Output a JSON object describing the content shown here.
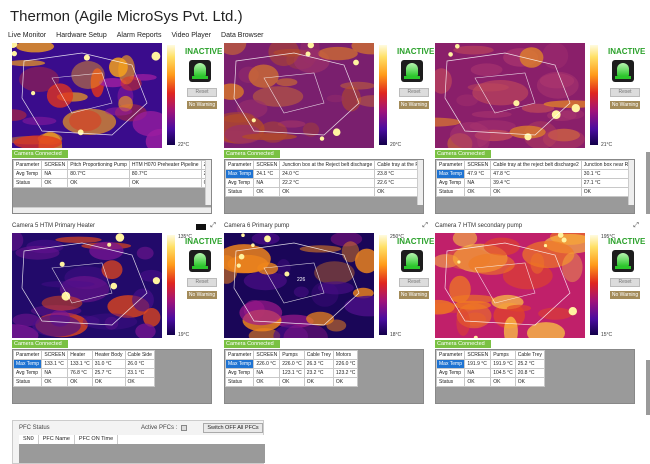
{
  "app": {
    "title": "Thermon (Agile MicroSys Pvt. Ltd.)"
  },
  "menu": [
    "Live Monitor",
    "Hardware Setup",
    "Alarm Reports",
    "Video Player",
    "Data Browser"
  ],
  "common": {
    "status": "INACTIVE",
    "reset": "Reset",
    "no_warning": "No Warning",
    "connected": "Camera Connected",
    "expand_icon": "expand-arrows-icon",
    "colors": {
      "status_green": "#2aa12a",
      "connected_green": "#7ac143",
      "highlight_blue": "#1e73d2",
      "warning_tan": "#a38b5a"
    }
  },
  "cameras": [
    {
      "title": "",
      "temp_high": "",
      "temp_low": "22°C",
      "columns": [
        "Parameter",
        "SCREEN",
        "Pitch Proportioning Pump",
        "HTM H070 Preheater Pipeline",
        "Z"
      ],
      "rows": [
        [
          "Avg Temp",
          "NA",
          "80.7°C",
          "80.7°C",
          "2"
        ],
        [
          "Status",
          "OK",
          "OK",
          "OK",
          "C"
        ]
      ]
    },
    {
      "title": "",
      "temp_high": "",
      "temp_low": "20°C",
      "columns": [
        "Parameter",
        "SCREEN",
        "Junction box at the Reject belt discharge",
        "Cable tray at the Reject belt discharge"
      ],
      "rows": [
        [
          "Max Temp",
          "24.1 °C",
          "24.0 °C",
          "23.8 °C"
        ],
        [
          "Avg Temp",
          "NA",
          "22.2 °C",
          "22.6 °C"
        ],
        [
          "Status",
          "OK",
          "OK",
          "OK"
        ]
      ]
    },
    {
      "title": "",
      "temp_high": "",
      "temp_low": "21°C",
      "columns": [
        "Parameter",
        "SCREEN",
        "Cable tray at the reject belt discharge2",
        "Junction box near Reject Belt Infeed"
      ],
      "rows": [
        [
          "Max Temp",
          "47.9 °C",
          "47.8 °C",
          "30.1 °C"
        ],
        [
          "Avg Temp",
          "NA",
          "39.4 °C",
          "27.1 °C"
        ],
        [
          "Status",
          "OK",
          "OK",
          "OK"
        ]
      ]
    },
    {
      "title": "Camera 5 HTM Primary Heater",
      "temp_high": "135°C",
      "temp_low": "19°C",
      "columns": [
        "Parameter",
        "SCREEN",
        "Heater",
        "Heater Body",
        "Cable Side"
      ],
      "rows": [
        [
          "Max Temp",
          "133.1 °C",
          "133.1 °C",
          "31.0 °C",
          "26.0 °C"
        ],
        [
          "Avg Temp",
          "NA",
          "76.8 °C",
          "25.7 °C",
          "23.1 °C"
        ],
        [
          "Status",
          "OK",
          "OK",
          "OK",
          "OK"
        ]
      ]
    },
    {
      "title": "Camera 6 Primary pump",
      "temp_high": "250°C",
      "temp_low": "18°C",
      "hotspot": "226",
      "columns": [
        "Parameter",
        "SCREEN",
        "Pumps",
        "Cable Trey",
        "Motors"
      ],
      "rows": [
        [
          "Max Temp",
          "226.0 °C",
          "226.0 °C",
          "26.3 °C",
          "226.0 °C"
        ],
        [
          "Avg Temp",
          "NA",
          "123.1 °C",
          "23.2 °C",
          "123.2 °C"
        ],
        [
          "Status",
          "OK",
          "OK",
          "OK",
          "OK"
        ]
      ]
    },
    {
      "title": "Camera 7 HTM secondary pump",
      "temp_high": "195°C",
      "temp_low": "15°C",
      "columns": [
        "Parameter",
        "SCREEN",
        "Pumps",
        "Cable Trey"
      ],
      "rows": [
        [
          "Max Temp",
          "191.9 °C",
          "191.9 °C",
          "25.2 °C"
        ],
        [
          "Avg Temp",
          "NA",
          "104.5 °C",
          "20.8 °C"
        ],
        [
          "Status",
          "OK",
          "OK",
          "OK"
        ]
      ]
    }
  ],
  "pfc": {
    "title": "PFC Status",
    "active_label": "Active PFCs :",
    "switch_off_label": "Switch OFF All PFCs",
    "columns": [
      "SN0",
      "PFC Name",
      "PFC ON Time"
    ]
  }
}
